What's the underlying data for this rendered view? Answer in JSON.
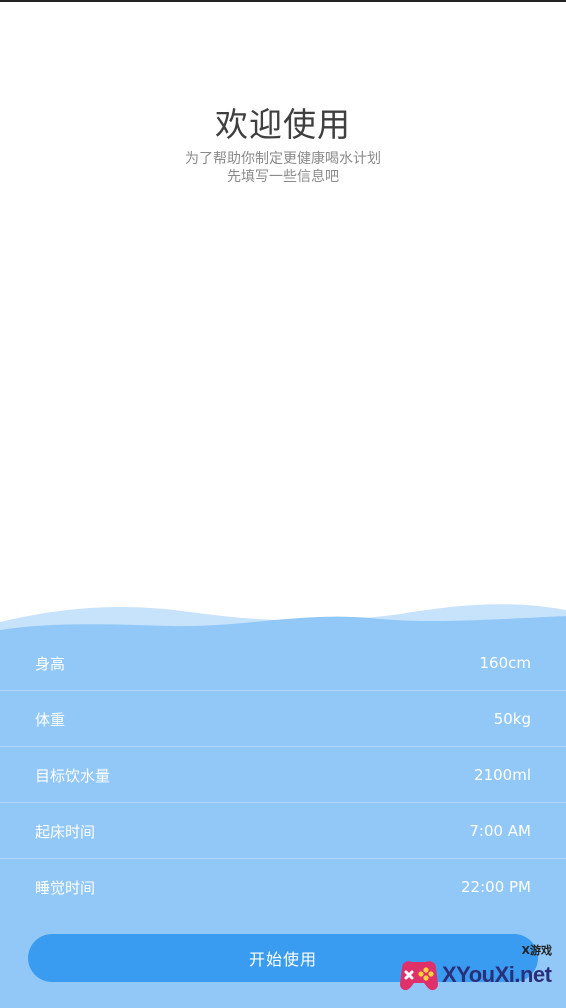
{
  "welcome": {
    "title": "欢迎使用",
    "subtitle_line1": "为了帮助你制定更健康喝水计划",
    "subtitle_line2": "先填写一些信息吧"
  },
  "settings": [
    {
      "label": "身高",
      "value": "160cm"
    },
    {
      "label": "体重",
      "value": "50kg"
    },
    {
      "label": "目标饮水量",
      "value": "2100ml"
    },
    {
      "label": "起床时间",
      "value": "7:00 AM"
    },
    {
      "label": "睡觉时间",
      "value": "22:00 PM"
    }
  ],
  "start_button": "开始使用",
  "watermark": {
    "top": "X游戏",
    "main": "XYouXi.net"
  },
  "colors": {
    "panel": "#92c8f8",
    "button": "#3a9cf0"
  }
}
